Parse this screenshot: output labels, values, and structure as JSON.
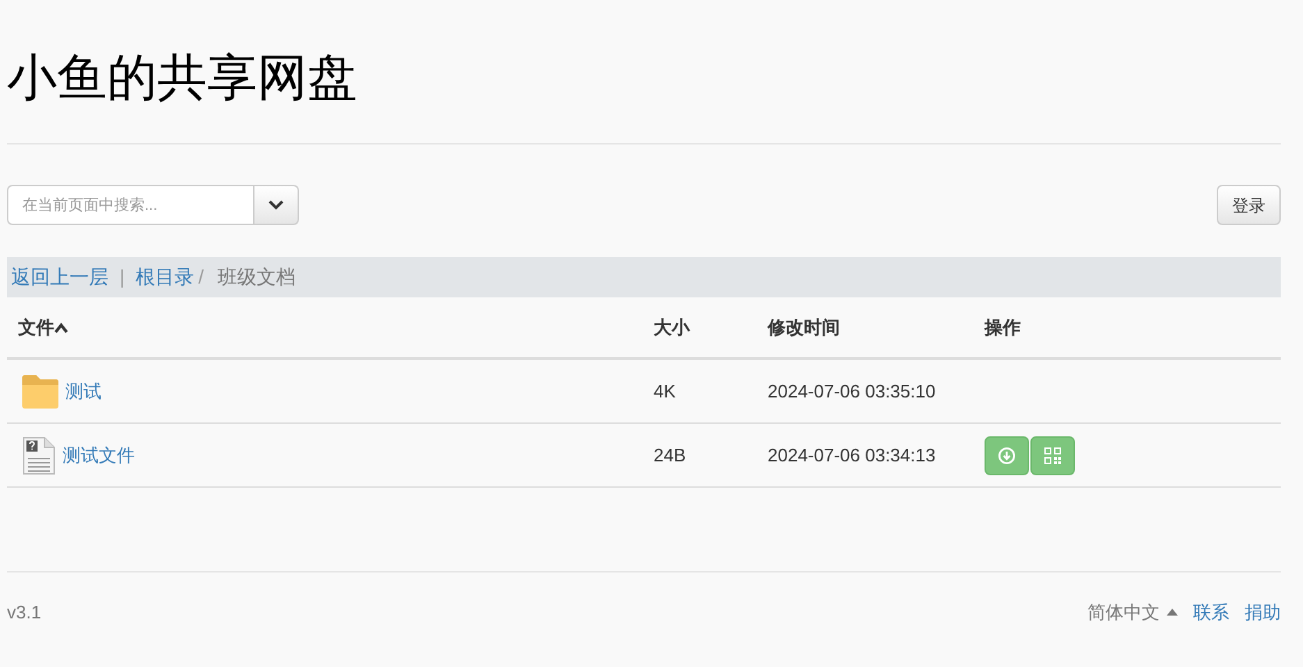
{
  "title": "小鱼的共享网盘",
  "search": {
    "placeholder": "在当前页面中搜索..."
  },
  "login_button": "登录",
  "breadcrumb": {
    "back": "返回上一层",
    "separator": "|",
    "root": "根目录",
    "divider": "/",
    "current": "班级文档"
  },
  "table": {
    "columns": [
      {
        "label": "文件",
        "sorted": true
      },
      {
        "label": "大小",
        "sorted": false
      },
      {
        "label": "修改时间",
        "sorted": false
      },
      {
        "label": "操作",
        "sorted": false
      }
    ],
    "rows": [
      {
        "kind": "folder",
        "name": "测试",
        "size": "4K",
        "modified": "2024-07-06 03:35:10",
        "actions": false
      },
      {
        "kind": "file",
        "name": "测试文件",
        "size": "24B",
        "modified": "2024-07-06 03:34:13",
        "actions": true
      }
    ]
  },
  "footer": {
    "version": "v3.1",
    "language": "简体中文",
    "links": [
      "联系",
      "捐助"
    ]
  }
}
